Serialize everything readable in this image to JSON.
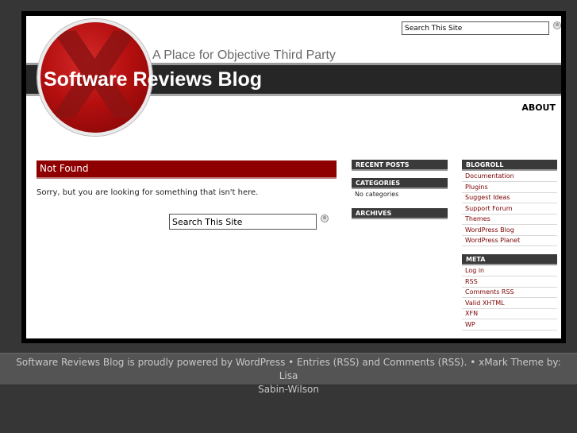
{
  "header": {
    "tagline": "A Place for Objective Third Party",
    "title": "Software Reviews Blog",
    "logo_letter": "X",
    "search_value": "Search This Site",
    "search_button_glyph": "⊜"
  },
  "nav": {
    "about": "ABOUT"
  },
  "main": {
    "heading": "Not Found",
    "message": "Sorry, but you are looking for something that isn't here.",
    "search_value": "Search This Site"
  },
  "sidebar_left": {
    "recent_posts": "RECENT POSTS",
    "categories": "CATEGORIES",
    "categories_empty": "No categories",
    "archives": "ARCHIVES"
  },
  "sidebar_right": {
    "blogroll": "BLOGROLL",
    "blogroll_links": [
      "Documentation",
      "Plugins",
      "Suggest Ideas",
      "Support Forum",
      "Themes",
      "WordPress Blog",
      "WordPress Planet"
    ],
    "meta": "META",
    "meta_links": [
      "Log in",
      "RSS",
      "Comments RSS",
      "Valid XHTML",
      "XFN",
      "WP"
    ]
  },
  "footer": {
    "line1": "Software Reviews Blog is proudly powered by WordPress • Entries (RSS) and Comments (RSS). • xMark Theme by: Lisa",
    "line2": "Sabin-Wilson"
  },
  "colors": {
    "accent_red": "#8e0000",
    "link_red": "#7a0000",
    "dark_bar": "#262626",
    "background": "#363636"
  }
}
